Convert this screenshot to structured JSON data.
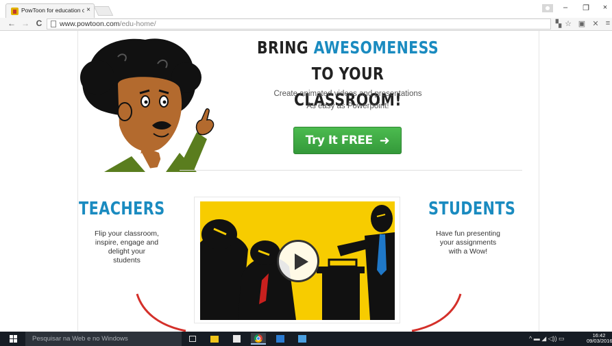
{
  "browser": {
    "tab_title": "PowToon for education on",
    "tab_close": "×",
    "address": {
      "host": "www.powtoon.com",
      "path": "/edu-home/"
    },
    "controls": {
      "back": "←",
      "forward": "→",
      "reload": "C",
      "minimize": "–",
      "restore": "❐",
      "close": "×",
      "bookmark": "☆",
      "menu": "≡"
    }
  },
  "hero": {
    "headline_line1_a": "BRING ",
    "headline_line1_highlight": "AWESOMENESS",
    "headline_line1_b": " TO YOUR",
    "headline_line2": "CLASSROOM!",
    "subline1": "Create animated videos and presentations",
    "subline2": "As easy as Powerpoint!",
    "cta_label": "Try It FREE",
    "cta_arrow": "➜"
  },
  "teachers": {
    "title": "TEACHERS",
    "lines": [
      "Flip your classroom,",
      "inspire, engage and",
      "delight your",
      "students"
    ]
  },
  "students": {
    "title": "STUDENTS",
    "lines": [
      "Have fun presenting",
      "your assignments",
      "with a Wow!"
    ]
  },
  "taskbar": {
    "search_placeholder": "Pesquisar na Web e no Windows",
    "time": "16:42",
    "date": "09/03/2016",
    "tray": "^ ▬ ◢ ◁)) ▭"
  },
  "colors": {
    "accent_blue": "#1a8bc0",
    "cta_green": "#3dab42",
    "video_yellow": "#f7cc00",
    "taskbar": "#161c24"
  }
}
